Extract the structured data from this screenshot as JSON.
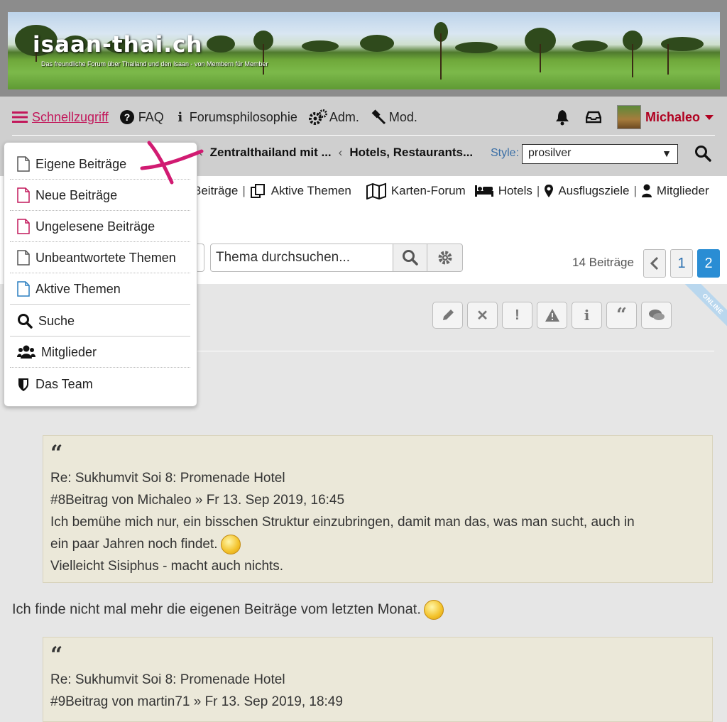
{
  "header": {
    "site_title": "isaan-thai.ch",
    "tagline": "Das freundliche Forum über Thailand und den Isaan - von Membern für Member"
  },
  "nav": {
    "quick_access": "Schnellzugriff",
    "faq": "FAQ",
    "philosophy": "Forumsphilosophie",
    "admin": "Adm.",
    "mod": "Mod.",
    "username": "Michaleo"
  },
  "breadcrumbs": [
    "Zentralthailand mit ...",
    "Hotels, Restaurants..."
  ],
  "style_picker": {
    "label": "Style:",
    "value": "prosilver"
  },
  "quick_links": {
    "beitraege_partial": "Beiträge",
    "aktive_themen": "Aktive Themen",
    "karten_forum": "Karten-Forum",
    "hotels": "Hotels",
    "ausflugsziele": "Ausflugsziele",
    "mitglieder": "Mitglieder"
  },
  "topic_search": {
    "placeholder": "Thema durchsuchen..."
  },
  "pagination": {
    "count": "14 Beiträge",
    "pages": [
      "1",
      "2"
    ],
    "current": "2"
  },
  "ribbon": "ONLINE",
  "dropdown": {
    "items": [
      {
        "label": "Eigene Beiträge",
        "icon": "page-icon",
        "color": "#555555"
      },
      {
        "label": "Neue Beiträge",
        "icon": "page-icon",
        "color": "#c2185b"
      },
      {
        "label": "Ungelesene Beiträge",
        "icon": "page-icon",
        "color": "#c2185b"
      },
      {
        "label": "Unbeantwortete Themen",
        "icon": "page-icon",
        "color": "#555555"
      },
      {
        "label": "Aktive Themen",
        "icon": "page-icon",
        "color": "#2a7fc0"
      },
      {
        "label": "Suche",
        "icon": "search-icon"
      },
      {
        "label": "Mitglieder",
        "icon": "users-icon"
      },
      {
        "label": "Das Team",
        "icon": "shield-icon"
      }
    ]
  },
  "post": {
    "quote1": {
      "title": "Re: Sukhumvit Soi 8: Promenade Hotel",
      "meta": "#8Beitrag von Michaleo » Fr 13. Sep 2019, 16:45",
      "line1": "Ich bemühe mich nur, ein bisschen Struktur einzubringen, damit man das, was man sucht, auch in",
      "line2": "ein paar Jahren noch findet.",
      "line3": "Vielleicht Sisiphus - macht auch nichts."
    },
    "text": "Ich finde nicht mal mehr die eigenen Beiträge vom letzten Monat.",
    "quote2": {
      "title": "Re: Sukhumvit Soi 8: Promenade Hotel",
      "meta": "#9Beitrag von martin71 » Fr 13. Sep 2019, 18:49"
    }
  },
  "colors": {
    "accent_pink": "#c2185b",
    "username_red": "#b00020",
    "page_blue": "#2a8dd4",
    "quote_bg": "#ebe8d9"
  }
}
